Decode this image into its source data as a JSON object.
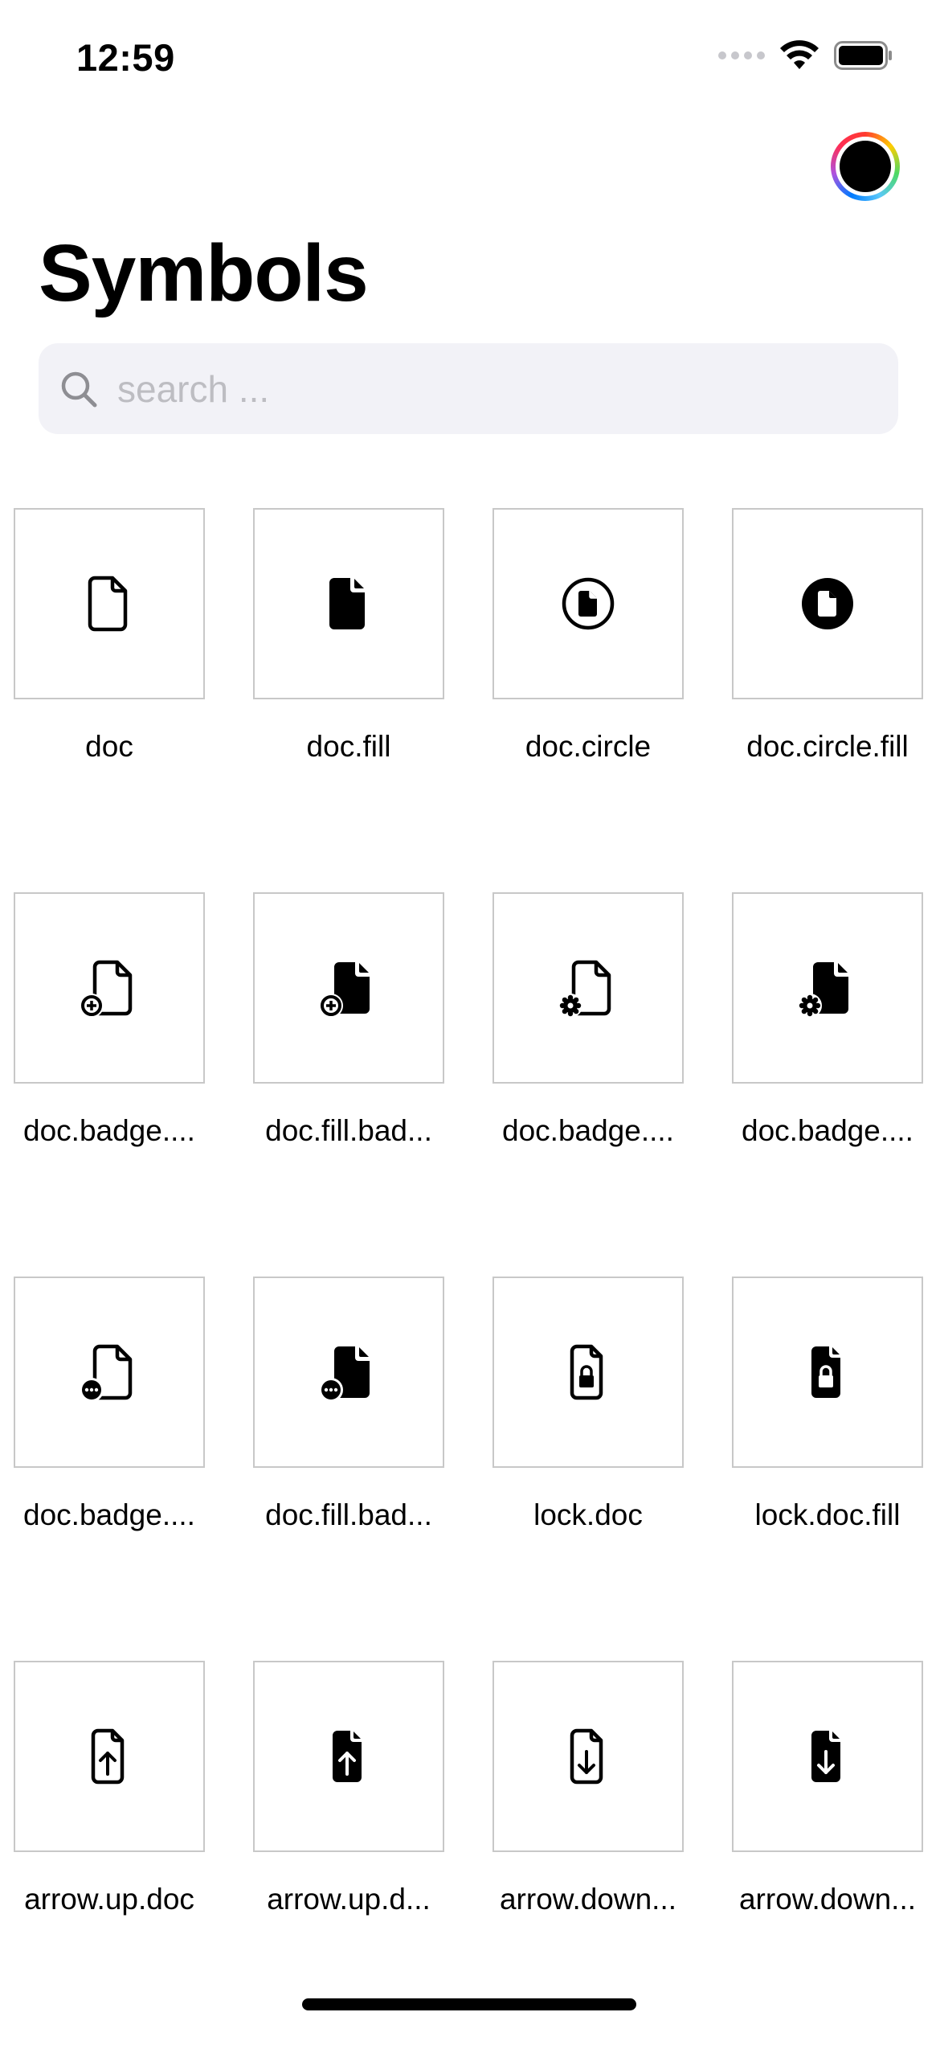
{
  "status_bar": {
    "time": "12:59"
  },
  "header": {
    "title": "Symbols"
  },
  "search": {
    "placeholder": "search ...",
    "value": ""
  },
  "color_picker": {
    "selected_color": "#000000"
  },
  "symbols": [
    {
      "label": "doc",
      "icon": "doc"
    },
    {
      "label": "doc.fill",
      "icon": "doc.fill"
    },
    {
      "label": "doc.circle",
      "icon": "doc.circle"
    },
    {
      "label": "doc.circle.fill",
      "icon": "doc.circle.fill"
    },
    {
      "label": "doc.badge....",
      "icon": "doc.badge.plus"
    },
    {
      "label": "doc.fill.bad...",
      "icon": "doc.fill.badge.plus"
    },
    {
      "label": "doc.badge....",
      "icon": "doc.badge.gearshape"
    },
    {
      "label": "doc.badge....",
      "icon": "doc.badge.gearshape.fill"
    },
    {
      "label": "doc.badge....",
      "icon": "doc.badge.ellipsis"
    },
    {
      "label": "doc.fill.bad...",
      "icon": "doc.fill.badge.ellipsis"
    },
    {
      "label": "lock.doc",
      "icon": "lock.doc"
    },
    {
      "label": "lock.doc.fill",
      "icon": "lock.doc.fill"
    },
    {
      "label": "arrow.up.doc",
      "icon": "arrow.up.doc"
    },
    {
      "label": "arrow.up.d...",
      "icon": "arrow.up.doc.fill"
    },
    {
      "label": "arrow.down...",
      "icon": "arrow.down.doc"
    },
    {
      "label": "arrow.down...",
      "icon": "arrow.down.doc.fill"
    }
  ]
}
